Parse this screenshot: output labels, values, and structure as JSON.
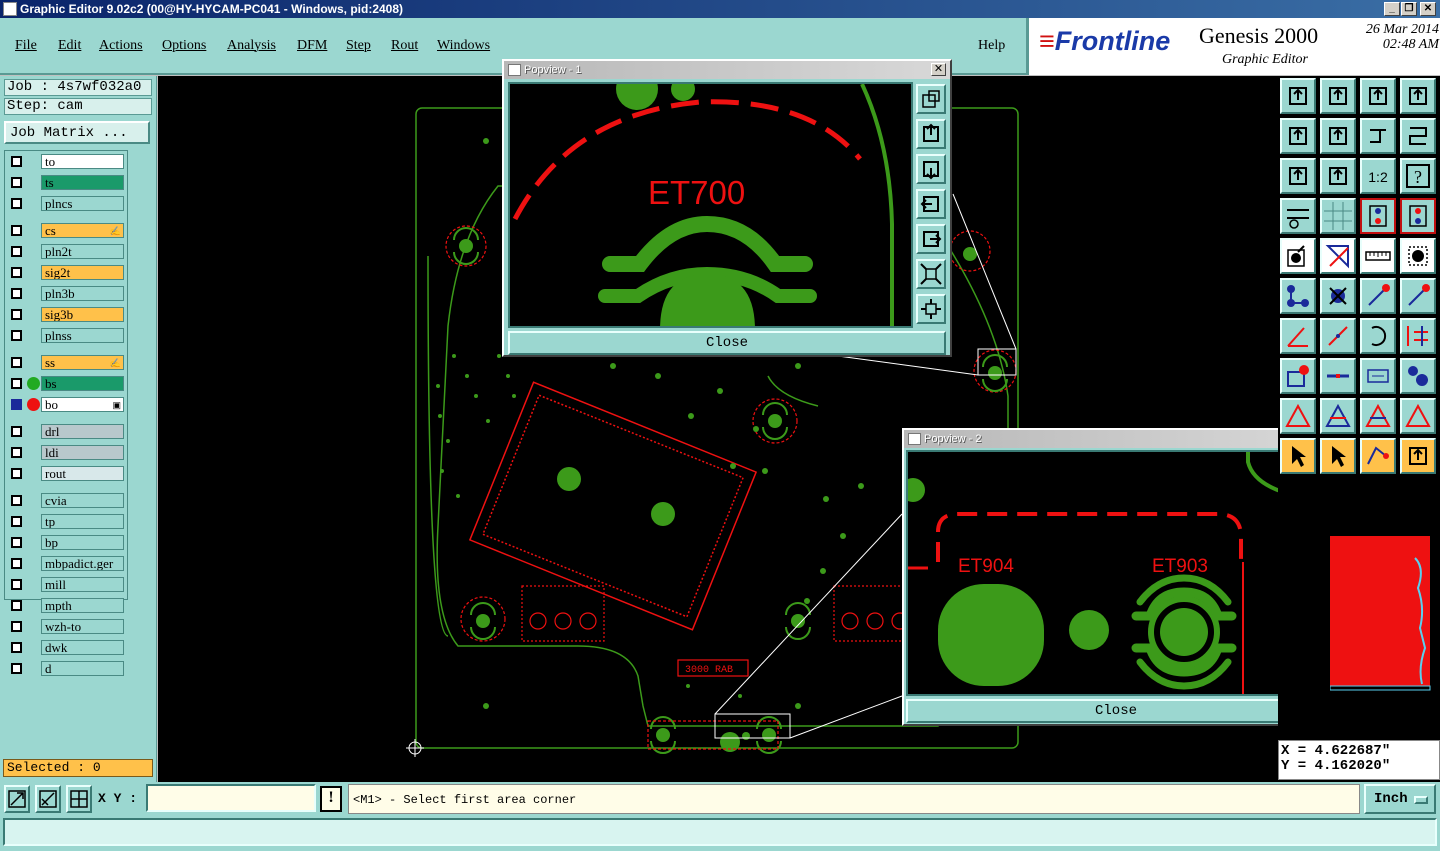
{
  "window": {
    "title": "Graphic Editor 9.02c2 (00@HY-HYCAM-PC041 - Windows, pid:2408)",
    "buttons": [
      "_",
      "❐",
      "✕"
    ]
  },
  "menu": [
    "File",
    "Edit",
    "Actions",
    "Options",
    "Analysis",
    "DFM",
    "Step",
    "Rout",
    "Windows"
  ],
  "help": "Help",
  "brand": {
    "logo": "Frontline",
    "product": "Genesis 2000",
    "subtitle": "Graphic Editor",
    "date": "26 Mar 2014",
    "time": "02:48 AM"
  },
  "job": {
    "job_label": "Job : 4s7wf032a0",
    "step_label": "Step: cam",
    "matrix_button": "Job Matrix ..."
  },
  "layers": [
    {
      "name": "to",
      "bg": "#ffffff"
    },
    {
      "name": "ts",
      "bg": "#1a9a6a"
    },
    {
      "name": "plncs",
      "bg": "#9bd7d0"
    },
    {
      "name": "cs",
      "bg": "#ffc14a",
      "mark": "✍"
    },
    {
      "name": "pln2t",
      "bg": "#9bd7d0"
    },
    {
      "name": "sig2t",
      "bg": "#ffc14a"
    },
    {
      "name": "pln3b",
      "bg": "#9bd7d0"
    },
    {
      "name": "sig3b",
      "bg": "#ffc14a"
    },
    {
      "name": "plnss",
      "bg": "#9bd7d0"
    },
    {
      "name": "ss",
      "bg": "#ffc14a",
      "mark": "✍"
    },
    {
      "name": "bs",
      "bg": "#1a9a6a",
      "dot": "#22aa22"
    },
    {
      "name": "bo",
      "bg": "#ffffff",
      "dot": "#ee1111",
      "checked": true,
      "mark": "▣"
    },
    {
      "name": "drl",
      "bg": "#b8c8cc"
    },
    {
      "name": "ldi",
      "bg": "#b8c8cc"
    },
    {
      "name": "rout",
      "bg": "#d8e8ea"
    },
    {
      "name": "cvia",
      "bg": "#9bd7d0"
    },
    {
      "name": "tp",
      "bg": "#9bd7d0"
    },
    {
      "name": "bp",
      "bg": "#9bd7d0"
    },
    {
      "name": "mbpadict.ger",
      "bg": "#9bd7d0"
    },
    {
      "name": "mill",
      "bg": "#9bd7d0"
    },
    {
      "name": "mpth",
      "bg": "#9bd7d0"
    },
    {
      "name": "wzh-to",
      "bg": "#9bd7d0"
    },
    {
      "name": "dwk",
      "bg": "#9bd7d0"
    },
    {
      "name": "d",
      "bg": "#9bd7d0"
    }
  ],
  "selected": "Selected : 0",
  "board_labels": {
    "test_point": "3000 RAB",
    "mark1": "ET700",
    "mark2": "ET904",
    "mark3": "ET903"
  },
  "popview1": {
    "title": "Popview - 1",
    "close": "Close",
    "label": "ET700"
  },
  "popview2": {
    "title": "Popview - 2",
    "close": "Close",
    "label_left": "ET904",
    "label_right": "ET903"
  },
  "coords": {
    "x": "X = 4.622687\"",
    "y": "Y = 4.162020\""
  },
  "bottom": {
    "xy_label": "X Y :",
    "xy_value": "",
    "excl": "!",
    "prompt": "<M1> - Select first area corner",
    "unit": "Inch"
  },
  "colors": {
    "accent": "#9bd7d0",
    "pad_green": "#3c9a1a",
    "feature_red": "#ee1111"
  }
}
